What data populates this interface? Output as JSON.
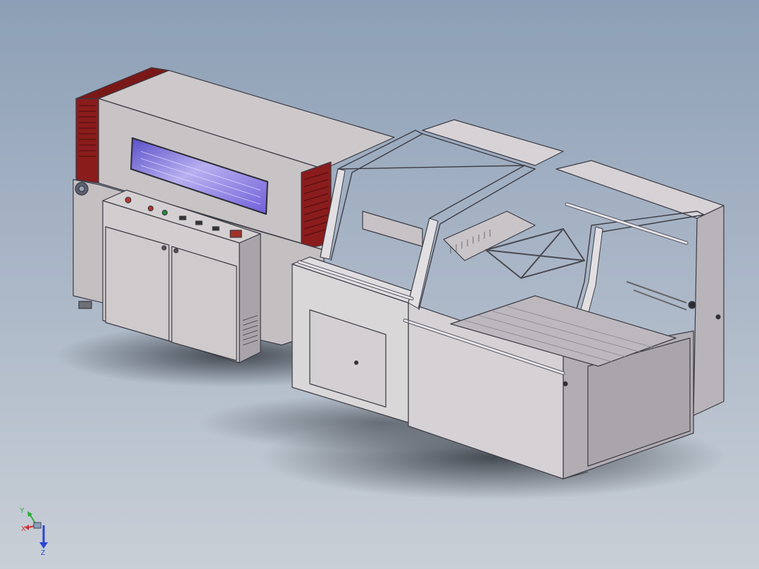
{
  "viewport": {
    "background_top": "#8d9fb6",
    "background_bottom": "#c9cfd6",
    "model_colors": {
      "panel_light": "#dcdadc",
      "panel_mid": "#c9c4c8",
      "panel_dark": "#a7a2a8",
      "accent_red": "#8a1c1c",
      "window_glow": "#7b6fd6",
      "outline": "#3c3c44"
    }
  },
  "triad": {
    "x_label": "X",
    "y_label": "Y",
    "z_label": "Z",
    "x_color": "#d23232",
    "y_color": "#2eaa3a",
    "z_color": "#2a44d6"
  }
}
